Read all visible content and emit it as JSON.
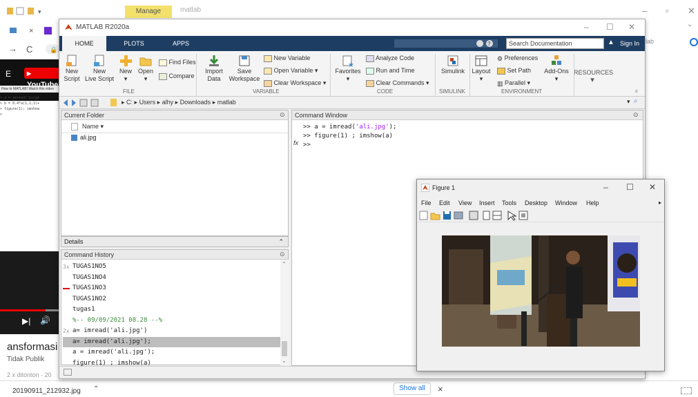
{
  "explorer": {
    "manage_tab": "Manage",
    "folder_title": "matlab",
    "side_label": "lab"
  },
  "browser": {
    "tab_x": "×",
    "youtube_logo": "YouTube",
    "caption": "How to MATLAB! Watch this video",
    "bg_code": "> a = imread('pinge\n> b = 0.4*a(1,1,1)+\n> figure(1); imshow\n>",
    "video_title": "ansformasi C",
    "video_sub": "Tidak Publik",
    "video_views": "2 x ditonton · 20"
  },
  "download_bar": {
    "file": "20190911_212932.jpg",
    "show_all": "Show all",
    "close": "×"
  },
  "matlab": {
    "title": "MATLAB R2020a",
    "tabs": [
      "HOME",
      "PLOTS",
      "APPS"
    ],
    "search_placeholder": "Search Documentation",
    "sign_in": "Sign In",
    "ribbon": {
      "new_script": "New\nScript",
      "new_live_script": "New\nLive Script",
      "new": "New",
      "open": "Open",
      "find_files": "Find Files",
      "compare": "Compare",
      "import_data": "Import\nData",
      "save_workspace": "Save\nWorkspace",
      "new_variable": "New Variable",
      "open_variable": "Open Variable ▾",
      "clear_workspace": "Clear Workspace ▾",
      "favorites": "Favorites",
      "analyze_code": "Analyze Code",
      "run_and_time": "Run and Time",
      "clear_commands": "Clear Commands ▾",
      "simulink": "Simulink",
      "layout": "Layout",
      "preferences": "Preferences",
      "set_path": "Set Path",
      "parallel": "Parallel ▾",
      "add_ons": "Add-Ons",
      "resources": "RESOURCES",
      "groups": [
        "FILE",
        "VARIABLE",
        "CODE",
        "SIMULINK",
        "ENVIRONMENT"
      ]
    },
    "path": [
      "C:",
      "Users",
      "alhy",
      "Downloads",
      "matlab"
    ],
    "current_folder": {
      "title": "Current Folder",
      "col_name": "Name ▾",
      "files": [
        "ali.jpg"
      ]
    },
    "details": "Details",
    "history": {
      "title": "Command History",
      "items": [
        {
          "mark": "3x",
          "text": "TUGAS1NO5",
          "sel": false,
          "err": false
        },
        {
          "mark": "",
          "text": "TUGAS1NO4",
          "sel": false,
          "err": false
        },
        {
          "mark": "",
          "text": "TUGAS1NO3",
          "sel": false,
          "err": true
        },
        {
          "mark": "",
          "text": "TUGAS1NO2",
          "sel": false,
          "err": false
        },
        {
          "mark": "",
          "text": "tugas1",
          "sel": false,
          "err": false
        },
        {
          "mark": "",
          "text": "%-- 09/09/2021 08.28 --%",
          "sel": false,
          "err": false,
          "comment": true
        },
        {
          "mark": "2x",
          "text": "a= imread('ali.jpg')",
          "sel": false,
          "err": false
        },
        {
          "mark": "",
          "text": "a= imread('ali.jpg');",
          "sel": true,
          "err": false
        },
        {
          "mark": "",
          "text": "a = imread('ali.jpg');",
          "sel": false,
          "err": false
        },
        {
          "mark": "",
          "text": "figure(1) ; imshow(a)",
          "sel": false,
          "err": false
        }
      ]
    },
    "command_window": {
      "title": "Command Window",
      "lines": [
        {
          "pre": ">> a = imread(",
          "str": "'ali.jpg'",
          "post": ");"
        },
        {
          "pre": ">> figure(1) ; imshow(a)",
          "str": "",
          "post": ""
        },
        {
          "pre": ">>",
          "str": "",
          "post": ""
        }
      ],
      "fx": "fx"
    }
  },
  "figure": {
    "title": "Figure 1",
    "menus": [
      "File",
      "Edit",
      "View",
      "Insert",
      "Tools",
      "Desktop",
      "Window",
      "Help"
    ]
  }
}
